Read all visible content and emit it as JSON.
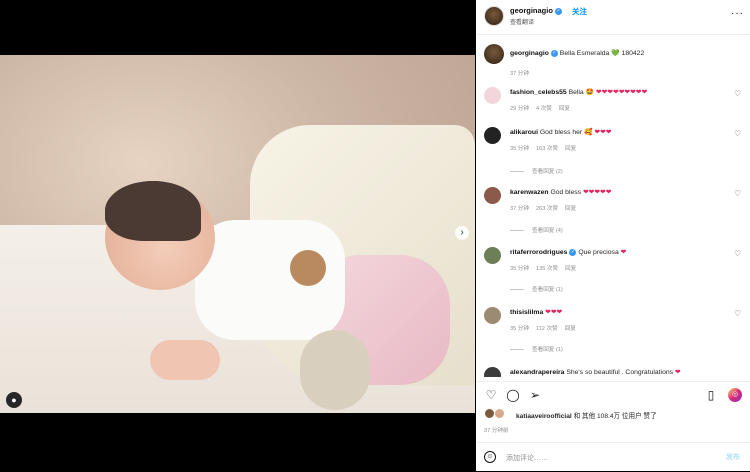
{
  "header": {
    "username": "georginagio",
    "follow_label": "关注",
    "subtitle": "查看翻译"
  },
  "caption": {
    "username": "georginagio",
    "text": "Bella Esmeralda",
    "emoji": "💚",
    "date_code": "180422",
    "time": "37 分钟"
  },
  "comments": [
    {
      "username": "fashion_celebs55",
      "text": "Bella 🤩",
      "hearts": "❤❤❤❤❤❤❤❤❤",
      "time": "29 分钟",
      "likes": "4 次赞",
      "reply": "回复"
    },
    {
      "username": "alikaroui",
      "text": "God bless her 🥰",
      "hearts": "❤❤❤",
      "time": "35 分钟",
      "likes": "163 次赞",
      "reply": "回复",
      "view_replies": "查看回复 (2)"
    },
    {
      "username": "karenwazen",
      "text": "God bless",
      "hearts": "❤❤❤❤❤",
      "time": "37 分钟",
      "likes": "263 次赞",
      "reply": "回复",
      "view_replies": "查看回复 (4)"
    },
    {
      "username": "ritaferrorodrigues",
      "text": "Que preciosa",
      "hearts": "❤",
      "time": "35 分钟",
      "likes": "135 次赞",
      "reply": "回复",
      "view_replies": "查看回复 (1)"
    },
    {
      "username": "thisislilma",
      "text": "",
      "hearts": "❤❤❤",
      "time": "35 分钟",
      "likes": "112 次赞",
      "reply": "回复",
      "view_replies": "查看回复 (1)"
    },
    {
      "username": "alexandrapereira",
      "text": "She's so beautiful . Congratulations",
      "hearts": "❤",
      "time": "",
      "likes": "",
      "reply": ""
    }
  ],
  "likes": {
    "liker": "katiaaveiroofficial",
    "rest": "和 其他 108.4万 位用户 赞了"
  },
  "post_time": "37 分钟前",
  "comment_box": {
    "placeholder": "添加评论……",
    "post_label": "发布"
  },
  "colors": {
    "accent": "#0095f6",
    "heart": "#e0245e",
    "secondary_text": "#8e8e8e"
  }
}
